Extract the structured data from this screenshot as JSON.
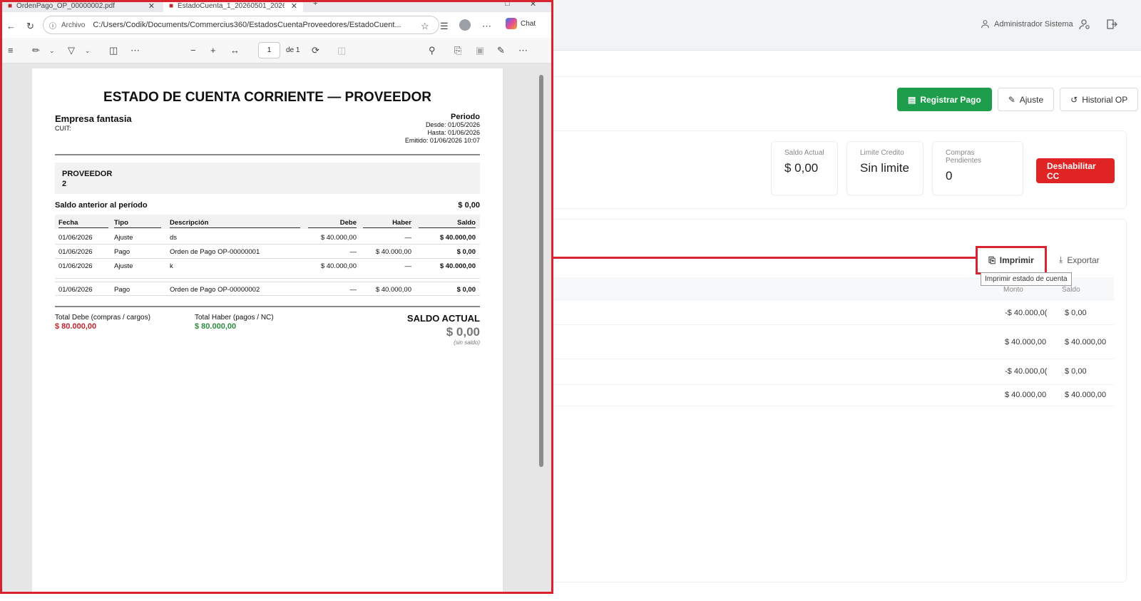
{
  "app": {
    "user_name": "Administrador Sistema",
    "actions": {
      "registrar_pago": "Registrar Pago",
      "ajuste": "Ajuste",
      "historial_op": "Historial OP"
    },
    "summary": {
      "saldo_actual_label": "Saldo Actual",
      "saldo_actual_value": "$ 0,00",
      "limite_label": "Limite Credito",
      "limite_value": "Sin limite",
      "compras_label": "Compras Pendientes",
      "compras_value": "0",
      "deshabilitar": "Deshabilitar CC"
    },
    "imprimir": "Imprimir",
    "exportar": "Exportar",
    "tooltip": "Imprimir estado de cuenta",
    "mov_headers": {
      "monto": "Monto",
      "saldo": "Saldo"
    },
    "mov_rows": [
      {
        "monto": "-$ 40.000,0(",
        "saldo": "$ 0,00"
      },
      {
        "monto": "$ 40.000,00",
        "saldo": "$ 40.000,00"
      },
      {
        "monto": "-$ 40.000,0(",
        "saldo": "$ 0,00"
      },
      {
        "monto": "$ 40.000,00",
        "saldo": "$ 40.000,00"
      }
    ]
  },
  "browser": {
    "tabs": [
      {
        "title": "OrdenPago_OP_00000002.pdf"
      },
      {
        "title": "EstadoCuenta_1_20260501_2026"
      }
    ],
    "address_label": "Archivo",
    "url": "C:/Users/Codik/Documents/Commercius360/EstadosCuentaProveedores/EstadoCuent...",
    "chat_label": "Chat",
    "page_current": "1",
    "page_total": "de 1"
  },
  "pdf": {
    "title": "ESTADO DE CUENTA CORRIENTE — PROVEEDOR",
    "empresa": "Empresa fantasia",
    "cuit": "CUIT:",
    "periodo_label": "Periodo",
    "desde": "Desde: 01/05/2026",
    "hasta": "Hasta: 01/06/2026",
    "emitido": "Emitido: 01/06/2026 10:07",
    "proveedor_label": "PROVEEDOR",
    "proveedor_value": "2",
    "saldo_anterior_label": "Saldo anterior al período",
    "saldo_anterior_value": "$ 0,00",
    "table": {
      "headers": {
        "fecha": "Fecha",
        "tipo": "Tipo",
        "descripcion": "Descripción",
        "debe": "Debe",
        "haber": "Haber",
        "saldo": "Saldo"
      },
      "rows": [
        {
          "fecha": "01/06/2026",
          "tipo": "Ajuste",
          "descripcion": "ds",
          "debe": "$ 40.000,00",
          "haber": "—",
          "saldo": "$ 40.000,00"
        },
        {
          "fecha": "01/06/2026",
          "tipo": "Pago",
          "descripcion": "Orden de Pago OP-00000001",
          "debe": "—",
          "haber": "$ 40.000,00",
          "saldo": "$ 0,00"
        },
        {
          "fecha": "01/06/2026",
          "tipo": "Ajuste",
          "descripcion": "k",
          "debe": "$ 40.000,00",
          "haber": "—",
          "saldo": "$ 40.000,00"
        },
        {
          "fecha": "01/06/2026",
          "tipo": "Pago",
          "descripcion": "Orden de Pago OP-00000002",
          "debe": "—",
          "haber": "$ 40.000,00",
          "saldo": "$ 0,00"
        }
      ]
    },
    "total_debe_label": "Total Debe (compras / cargos)",
    "total_debe_value": "$ 80.000,00",
    "total_haber_label": "Total Haber (pagos / NC)",
    "total_haber_value": "$ 80.000,00",
    "saldo_actual_label": "SALDO ACTUAL",
    "saldo_actual_value": "$ 0,00",
    "saldo_note": "(sin saldo)"
  },
  "colors": {
    "highlight": "#d9232e",
    "green": "#1e9e4c",
    "red": "#e02424"
  }
}
